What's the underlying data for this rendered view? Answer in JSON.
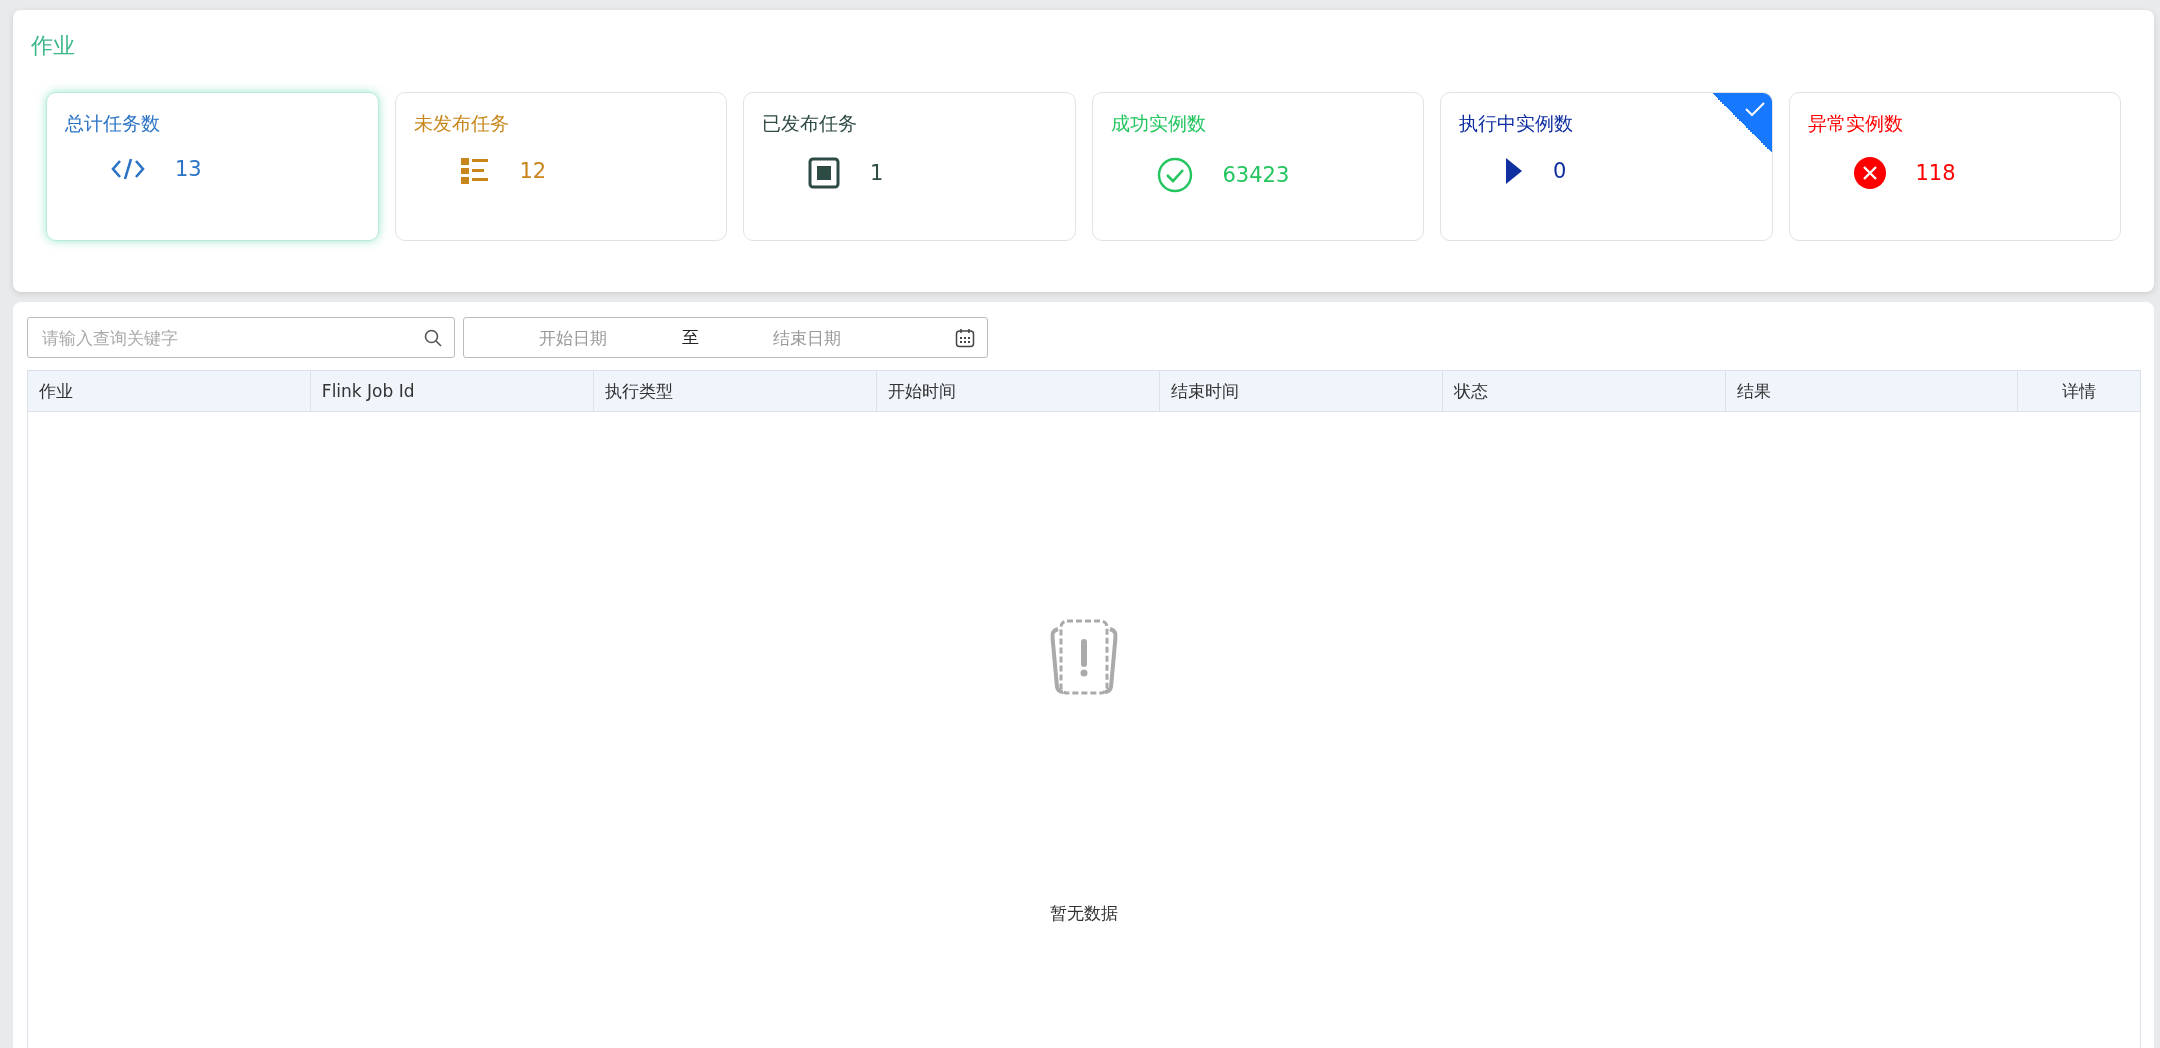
{
  "section_title": "作业",
  "stat_cards": [
    {
      "label": "总计任务数",
      "value": "13",
      "kind": "code",
      "color": "#2a73c5",
      "focused": true,
      "selected": false
    },
    {
      "label": "未发布任务",
      "value": "12",
      "kind": "list",
      "color": "#c8861a",
      "focused": false,
      "selected": false
    },
    {
      "label": "已发布任务",
      "value": "1",
      "kind": "stop",
      "color": "#2e4a45",
      "focused": false,
      "selected": false
    },
    {
      "label": "成功实例数",
      "value": "63423",
      "kind": "success",
      "color": "#22c55e",
      "focused": false,
      "selected": false
    },
    {
      "label": "执行中实例数",
      "value": "0",
      "kind": "running",
      "color": "#0f2fa0",
      "focused": false,
      "selected": true
    },
    {
      "label": "异常实例数",
      "value": "118",
      "kind": "error",
      "color": "#ff0000",
      "focused": false,
      "selected": false
    }
  ],
  "search": {
    "placeholder": "请输入查询关键字"
  },
  "date_range": {
    "start_placeholder": "开始日期",
    "separator": "至",
    "end_placeholder": "结束日期"
  },
  "table": {
    "columns": [
      "作业",
      "Flink Job Id",
      "执行类型",
      "开始时间",
      "结束时间",
      "状态",
      "结果",
      "详情"
    ],
    "empty_text": "暂无数据"
  }
}
